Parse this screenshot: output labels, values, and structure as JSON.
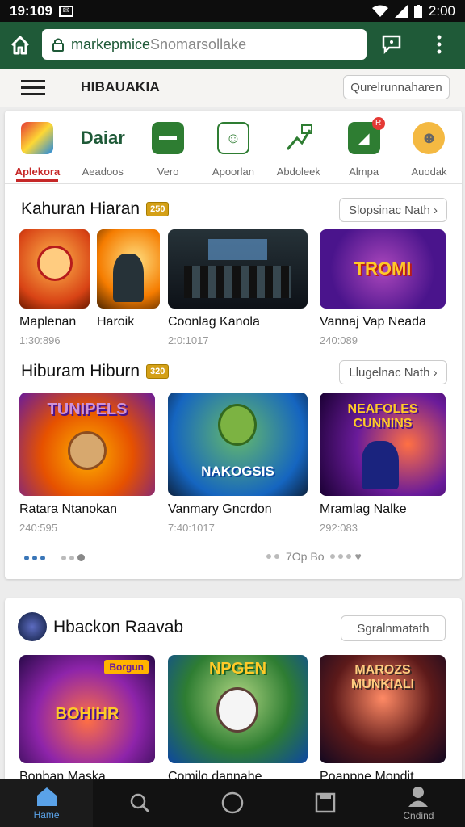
{
  "status": {
    "time": "19:109",
    "time_right": "2:00"
  },
  "browser": {
    "url_domain": "markepmice",
    "url_rest": "Snomarsollake"
  },
  "appbar": {
    "title": "HIBAUAKIA",
    "button": "Qurelrunnaharen"
  },
  "categories": [
    {
      "label": "Aplekora",
      "active": true
    },
    {
      "label": "Aeadoos",
      "icon_text": "Daiar"
    },
    {
      "label": "Vero"
    },
    {
      "label": "Apoorlan"
    },
    {
      "label": "Abdoleek"
    },
    {
      "label": "Almpa"
    },
    {
      "label": "Auodak"
    }
  ],
  "section1": {
    "title": "Kahuran Hiaran",
    "badge": "250",
    "more": "Slopsinac Nath",
    "items": [
      {
        "name": "Maplenan",
        "meta": "1:30:896"
      },
      {
        "name": "Haroik",
        "meta": ""
      },
      {
        "name": "Coonlag Kanola",
        "meta": "2:0:1017"
      },
      {
        "name": "Vannaj Vap Neada",
        "meta": "240:089"
      }
    ]
  },
  "section2": {
    "title": "Hiburam Hiburn",
    "badge": "320",
    "more": "Llugelnac Nath",
    "items": [
      {
        "name": "Ratara Ntanokan",
        "meta": "240:595",
        "art": "TUNIPELS"
      },
      {
        "name": "Vanmary Gncrdon",
        "meta": "7:40:1017",
        "art": "NAKOGSIS"
      },
      {
        "name": "Mramlag Nalke",
        "meta": "292:083",
        "art": "NEAFOLES CUNNINS"
      }
    ],
    "pager_text": "7Op Bo"
  },
  "section3": {
    "title": "Hbackon Raavab",
    "more": "Sgralnmatath",
    "items": [
      {
        "name": "Bonban Maska",
        "art": "BOHIHR",
        "art_top": "Borgun"
      },
      {
        "name": "Comilo dannahe",
        "art": "NPGEN"
      },
      {
        "name": "Poanpne Mondit",
        "art": "MAROZS MUNKIALI"
      }
    ]
  },
  "art_labels": {
    "s1_tile4": "TROMI"
  },
  "nav": [
    {
      "label": "Hame",
      "icon": "home-icon",
      "active": true
    },
    {
      "label": "",
      "icon": "search-icon"
    },
    {
      "label": "",
      "icon": "circle-icon"
    },
    {
      "label": "",
      "icon": "square-icon"
    },
    {
      "label": "Cndind",
      "icon": "person-icon"
    }
  ],
  "colors": {
    "browser_bar": "#1f5a38",
    "accent_red": "#c62828",
    "nav_active": "#5aa2e8",
    "badge": "#d4a017"
  }
}
